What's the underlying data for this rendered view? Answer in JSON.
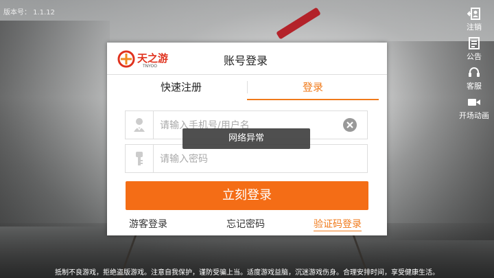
{
  "version_text": "版本号：  1.1.12",
  "side_menu": {
    "logout": "注销",
    "notice": "公告",
    "service": "客服",
    "opening_anim": "开场动画"
  },
  "dialog": {
    "logo_text": "天之游",
    "logo_sub": "TNYOO",
    "title": "账号登录",
    "tabs": {
      "quick_register": "快速注册",
      "login": "登录"
    },
    "username_placeholder": "请输入手机号/用户名",
    "password_placeholder": "请输入密码",
    "login_button": "立刻登录",
    "links": {
      "guest": "游客登录",
      "forgot": "忘记密码",
      "code_login": "验证码登录"
    },
    "toast": "网络异常"
  },
  "footer_notice": "抵制不良游戏，拒绝盗版游戏。注意自我保护，谨防受骗上当。适度游戏益脑，沉迷游戏伤身。合理安排时间，享受健康生活。",
  "colors": {
    "accent": "#f46d16",
    "tab_active": "#f07a1a"
  }
}
